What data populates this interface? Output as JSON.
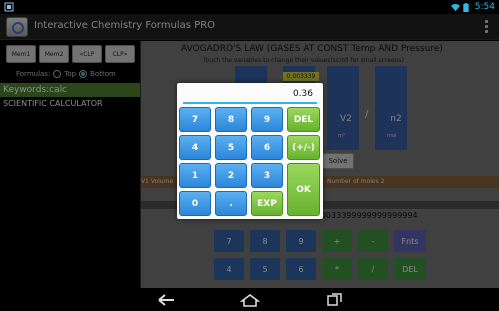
{
  "status_bar": {
    "time": "5:54",
    "icons": [
      "notification-icon",
      "wifi-icon",
      "battery-icon"
    ]
  },
  "action_bar": {
    "title": "Interactive Chemistry Formulas PRO",
    "overflow_icon": "overflow-menu-icon"
  },
  "left_panel": {
    "memory_buttons": [
      "Mem1",
      "Mem2",
      "«CLP",
      "CLP»"
    ],
    "formulas_label": "Formulas:",
    "radio_top": "Top",
    "radio_bottom": "Bottom",
    "selected_position": "Bottom",
    "keywords": "Keywords:calc",
    "items": [
      "SCIENTIFIC CALCULATOR"
    ]
  },
  "formula": {
    "title": "AVOGADRO'S LAW (GASES AT CONST Temp AND Pressure)",
    "hint": "Touch the variables to change their values(scroll for small screens)",
    "var_value": "0.003339",
    "v2": "V2",
    "slash": "/",
    "n2": "n2",
    "v2_unit": "m³",
    "n2_unit": "mol",
    "solve": "Solve",
    "info_left": "V1 Volume",
    "info_right": "Number of moles 2",
    "result": "2 3=.001492=0.0033399999999999994"
  },
  "bg_keys": {
    "row1": [
      "7",
      "8",
      "9",
      "+",
      "-",
      "Fnts"
    ],
    "row2": [
      "4",
      "5",
      "6",
      "*",
      "/",
      "DEL"
    ]
  },
  "dialog": {
    "display_value": "0.36",
    "keys": {
      "k7": "7",
      "k8": "8",
      "k9": "9",
      "del": "DEL",
      "k4": "4",
      "k5": "5",
      "k6": "6",
      "sign": "(+/-)",
      "k1": "1",
      "k2": "2",
      "k3": "3",
      "ok": "OK",
      "k0": "0",
      "dot": ".",
      "exp": "EXP"
    }
  },
  "nav_bar": {
    "icons": [
      "back-icon",
      "home-icon",
      "recents-icon"
    ]
  },
  "colors": {
    "accent": "#33b5e5",
    "key_blue": "#2c86d8",
    "key_green": "#67b22e"
  }
}
